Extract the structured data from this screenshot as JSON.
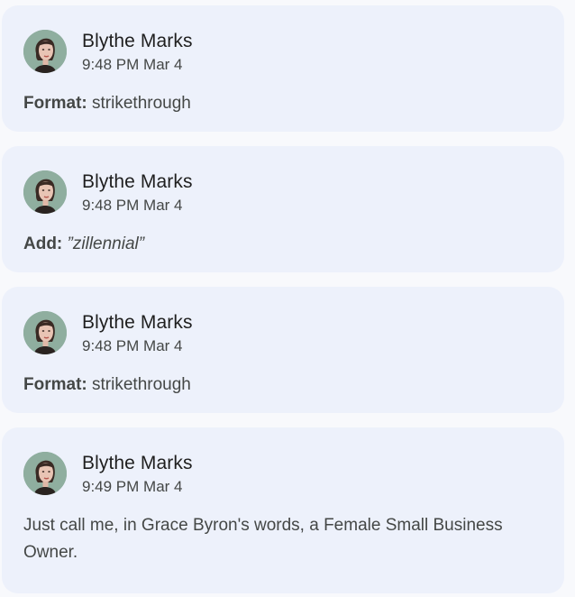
{
  "comments": [
    {
      "author": "Blythe Marks",
      "time": "9:48 PM Mar 4",
      "label": "Format:",
      "value": "strikethrough"
    },
    {
      "author": "Blythe Marks",
      "time": "9:48 PM Mar 4",
      "label": "Add:",
      "value": "”zillennial”"
    },
    {
      "author": "Blythe Marks",
      "time": "9:48 PM Mar 4",
      "label": "Format:",
      "value": "strikethrough"
    },
    {
      "author": "Blythe Marks",
      "time": "9:49 PM Mar 4",
      "text": "Just call me, in Grace Byron's words, a Female Small Business Owner."
    }
  ],
  "icons": {
    "avatar": "avatar-photo-icon"
  },
  "colors": {
    "card_background": "#edf1fb",
    "page_background": "#f8f9fc",
    "author_text": "#1f1f1f",
    "secondary_text": "#444746"
  }
}
